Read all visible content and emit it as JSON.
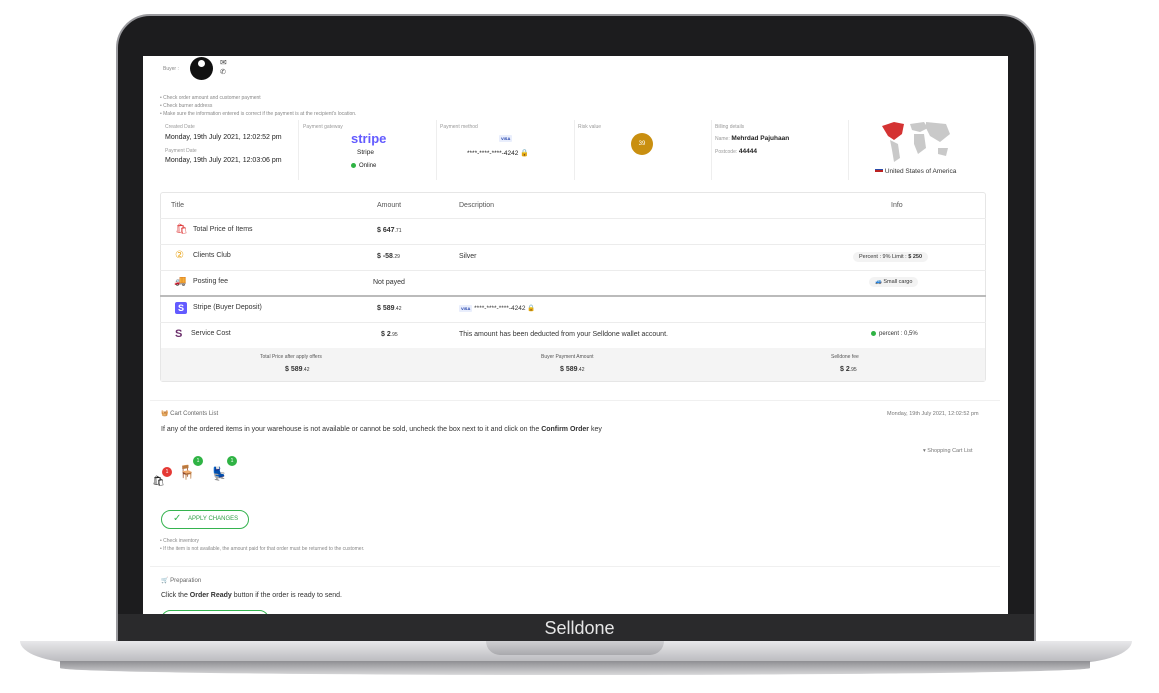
{
  "brand": "Selldone",
  "buyer": {
    "label": "Buyer :"
  },
  "checks": [
    "Check order amount and customer payment",
    "Check burner address",
    "Make sure the information entered is correct if the payment is at the recipient's location."
  ],
  "payment_info": {
    "created_date_label": "Created Date",
    "created_date": "Monday, 19th July 2021, 12:02:52 pm",
    "payment_date_label": "Payment Date",
    "payment_date": "Monday, 19th July 2021, 12:03:06 pm",
    "gateway_label": "Payment gateway",
    "gateway_logo": "stripe",
    "gateway_name": "Stripe",
    "gateway_status": "Online",
    "method_label": "Payment method",
    "card_brand": "VISA",
    "card_number": "****-****-****-4242",
    "risk_label": "Risk value",
    "risk_value": "39",
    "billing_label": "Billing details",
    "billing_name_label": "Name:",
    "billing_name": "Mehrdad Pajuhaan",
    "billing_postcode_label": "Postcode:",
    "billing_postcode": "44444",
    "country": "United States of America"
  },
  "table": {
    "headers": {
      "title": "Title",
      "amount": "Amount",
      "description": "Description",
      "info": "Info"
    },
    "rows": [
      {
        "title": "Total Price of Items",
        "amount": "$ 647",
        "amount_dec": ".71",
        "description": "",
        "info": ""
      },
      {
        "title": "Clients Club",
        "amount": "$ -58",
        "amount_dec": ".29",
        "description": "Silver",
        "info_percent": "Percent : 9%",
        "info_limit_label": "Limit :",
        "info_limit": "$ 250"
      },
      {
        "title": "Posting fee",
        "amount": "Not payed",
        "description": "",
        "info": "Small cargo"
      },
      {
        "title": "Stripe (Buyer Deposit)",
        "amount": "$ 589",
        "amount_dec": ".42",
        "card_brand": "VISA",
        "description": "****-****-****-4242"
      },
      {
        "title": "Service Cost",
        "amount": "$ 2",
        "amount_dec": ".95",
        "description": "This amount has been deducted from your Selldone wallet account.",
        "info": "percent : 0,5%"
      }
    ],
    "summary": [
      {
        "label": "Total Price after apply offers",
        "value": "$ 589",
        "dec": ".42"
      },
      {
        "label": "Buyer Payment Amount",
        "value": "$ 589",
        "dec": ".42"
      },
      {
        "label": "Selldone fee",
        "value": "$ 2",
        "dec": ".95"
      }
    ]
  },
  "cart": {
    "title": "Cart Contents List",
    "date": "Monday, 19th July 2021, 12:02:52 pm",
    "instruction_pre": "If any of the ordered items in your warehouse is not available or cannot be sold, uncheck the box next to it and click on the",
    "instruction_bold": "Confirm Order",
    "instruction_post": "key",
    "shopping_list_link": "Shopping Cart List",
    "badges": [
      "1",
      "1",
      "1"
    ],
    "apply_label": "APPLY CHANGES",
    "notes": [
      "Check inventory",
      "If the item is not available, the amount paid for that order must be returned to the customer."
    ]
  },
  "preparation": {
    "title": "Preparation",
    "instruction_pre": "Click the",
    "instruction_bold": "Order Ready",
    "instruction_post": "button if the order is ready to send."
  },
  "colors": {
    "accent_green": "#2fb344",
    "risk": "#c98f10",
    "stripe": "#635bff",
    "badge_red": "#e53935"
  }
}
